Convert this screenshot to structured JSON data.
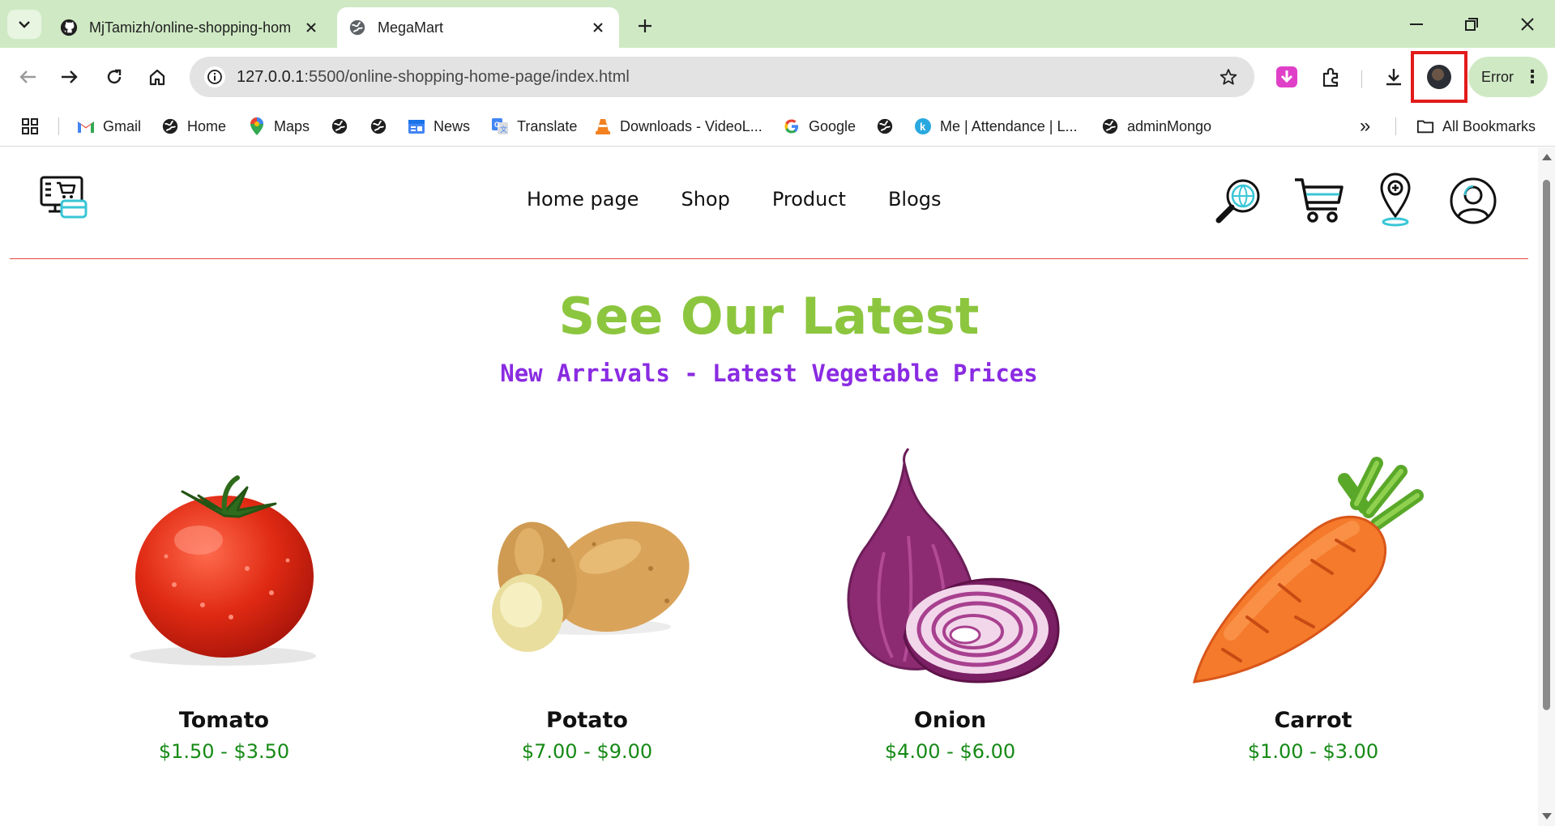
{
  "browser": {
    "tabs": [
      {
        "title": "MjTamizh/online-shopping-hom",
        "active": false
      },
      {
        "title": "MegaMart",
        "active": true
      }
    ],
    "url": {
      "host": "127.0.0.1",
      "path": ":5500/online-shopping-home-page/index.html"
    },
    "profile_status": "Error",
    "bookmarks": [
      {
        "label": "Gmail",
        "icon": "gmail-icon"
      },
      {
        "label": "Home",
        "icon": "globe-icon"
      },
      {
        "label": "Maps",
        "icon": "maps-icon"
      },
      {
        "label": "",
        "icon": "globe-icon"
      },
      {
        "label": "",
        "icon": "globe-icon"
      },
      {
        "label": "News",
        "icon": "news-icon"
      },
      {
        "label": "Translate",
        "icon": "translate-icon"
      },
      {
        "label": "Downloads - VideoL...",
        "icon": "vlc-icon"
      },
      {
        "label": "Google",
        "icon": "google-icon"
      },
      {
        "label": "",
        "icon": "globe-icon"
      },
      {
        "label": "Me | Attendance | L...",
        "icon": "k-icon"
      },
      {
        "label": "adminMongo",
        "icon": "globe-icon"
      }
    ],
    "all_bookmarks": "All Bookmarks",
    "overflow": "»"
  },
  "site": {
    "nav": [
      "Home page",
      "Shop",
      "Product",
      "Blogs"
    ],
    "hero_title": "See Our Latest",
    "hero_subtitle": "New Arrivals - Latest Vegetable Prices",
    "products": [
      {
        "name": "Tomato",
        "price": "$1.50 - $3.50"
      },
      {
        "name": "Potato",
        "price": "$7.00 - $9.00"
      },
      {
        "name": "Onion",
        "price": "$4.00 - $6.00"
      },
      {
        "name": "Carrot",
        "price": "$1.00 - $3.00"
      }
    ]
  },
  "colors": {
    "hero_title": "#8cc63f",
    "hero_subtitle": "#8a2be2",
    "price": "#168a16",
    "header_line": "#e24b3b",
    "tabstrip": "#cfe9c4"
  }
}
